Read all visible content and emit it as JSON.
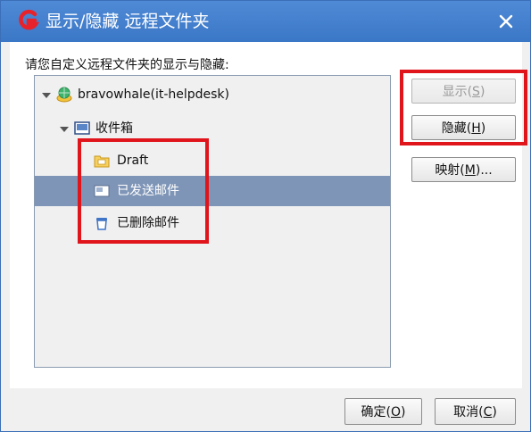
{
  "window": {
    "title": "显示/隐藏 远程文件夹",
    "accent_color": "#3a77c6",
    "logo_icon": "g-app-logo-icon",
    "close_icon": "close-icon"
  },
  "instruction": "请您自定义远程文件夹的显示与隐藏:",
  "tree": {
    "account": {
      "label": "bravowhale(it-helpdesk)",
      "icon": "account-globe-icon",
      "expanded": true
    },
    "inbox": {
      "label": "收件箱",
      "icon": "inbox-icon",
      "expanded": true
    },
    "children": [
      {
        "label": "Draft",
        "icon": "draft-folder-icon",
        "selected": false
      },
      {
        "label": "已发送邮件",
        "icon": "sent-mail-icon",
        "selected": true
      },
      {
        "label": "已删除邮件",
        "icon": "trash-icon",
        "selected": false
      }
    ]
  },
  "side_buttons": {
    "show": {
      "text": "显示(",
      "key": "S",
      "close": ")",
      "enabled": false
    },
    "hide": {
      "text": "隐藏(",
      "key": "H",
      "close": ")",
      "enabled": true
    },
    "map": {
      "text": "映射(",
      "key": "M",
      "close": ")...",
      "enabled": true
    }
  },
  "footer": {
    "ok": {
      "text": "确定(",
      "key": "O",
      "close": ")"
    },
    "cancel": {
      "text": "取消(",
      "key": "C",
      "close": ")"
    }
  },
  "highlight_color": "#e0151c"
}
